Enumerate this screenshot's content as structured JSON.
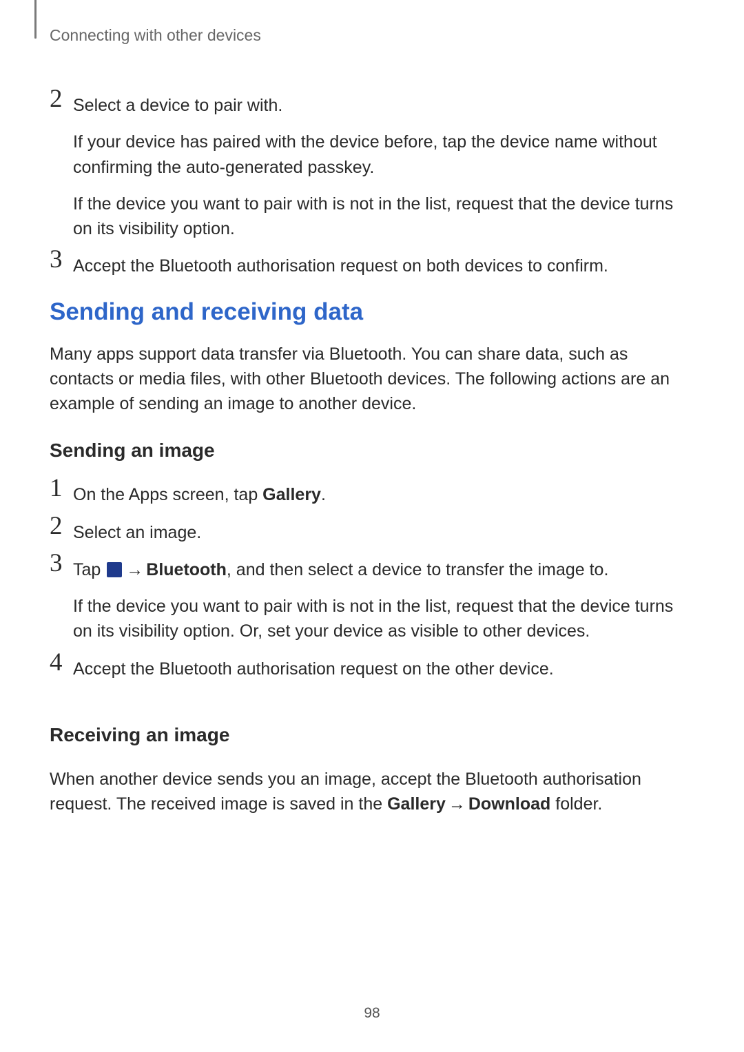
{
  "header": {
    "breadcrumb": "Connecting with other devices"
  },
  "topSteps": {
    "step2": {
      "num": "2",
      "line1": "Select a device to pair with.",
      "line2": "If your device has paired with the device before, tap the device name without confirming the auto-generated passkey.",
      "line3": "If the device you want to pair with is not in the list, request that the device turns on its visibility option."
    },
    "step3": {
      "num": "3",
      "line1": "Accept the Bluetooth authorisation request on both devices to confirm."
    }
  },
  "section": {
    "title": "Sending and receiving data",
    "intro": "Many apps support data transfer via Bluetooth. You can share data, such as contacts or media files, with other Bluetooth devices. The following actions are an example of sending an image to another device."
  },
  "sending": {
    "title": "Sending an image",
    "step1": {
      "num": "1",
      "prefix": "On the Apps screen, tap ",
      "bold": "Gallery",
      "suffix": "."
    },
    "step2": {
      "num": "2",
      "line1": "Select an image."
    },
    "step3": {
      "num": "3",
      "prefix": "Tap ",
      "arrow": " → ",
      "bold": "Bluetooth",
      "suffix": ", and then select a device to transfer the image to.",
      "line2": "If the device you want to pair with is not in the list, request that the device turns on its visibility option. Or, set your device as visible to other devices."
    },
    "step4": {
      "num": "4",
      "line1": "Accept the Bluetooth authorisation request on the other device."
    }
  },
  "receiving": {
    "title": "Receiving an image",
    "prefix": "When another device sends you an image, accept the Bluetooth authorisation request. The received image is saved in the ",
    "bold1": "Gallery",
    "arrow": " → ",
    "bold2": "Download",
    "suffix": " folder."
  },
  "pageNumber": "98"
}
